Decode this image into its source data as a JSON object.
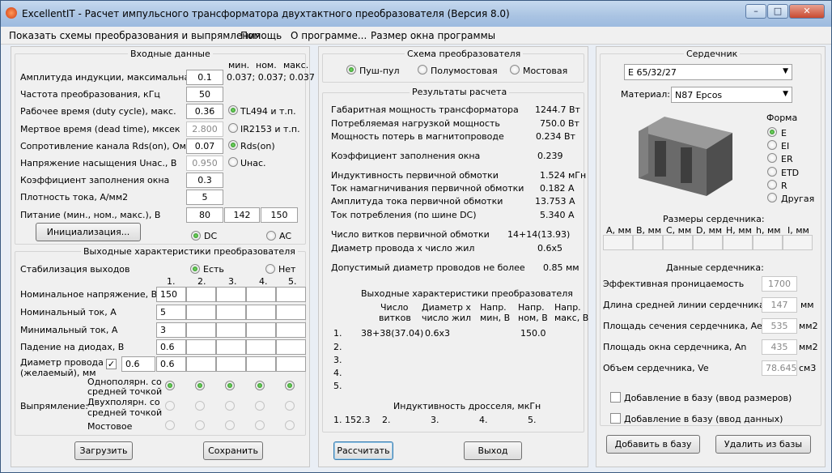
{
  "window": {
    "title": "ExcellentIT - Расчет импульсного трансформатора двухтактного преобразователя (Версия 8.0)",
    "minimize": "–",
    "maximize": "□",
    "close": "✕"
  },
  "menu": [
    "Показать схемы преобразования и выпрямления",
    "Помощь",
    "О программе...",
    "Размер окна программы"
  ],
  "input": {
    "title": "Входные данные",
    "col_headers": [
      "мин.",
      "ном.",
      "макс."
    ],
    "bmax_range": "0.037; 0.037; 0.037",
    "rows": [
      {
        "label": "Амплитуда индукции, максимальная, Т",
        "value": "0.1"
      },
      {
        "label": "Частота преобразования, кГц",
        "value": "50"
      },
      {
        "label": "Рабочее время (duty cycle), макс.",
        "value": "0.36"
      },
      {
        "label": "Мертвое время (dead time), мксек",
        "value": "2.800"
      },
      {
        "label": "Сопротивление канала Rds(on), Ом",
        "value": "0.07"
      },
      {
        "label": "Напряжение насыщения Uнас., В",
        "value": "0.950"
      },
      {
        "label": "Коэффициент заполнения окна",
        "value": "0.3"
      },
      {
        "label": "Плотность тока, А/мм2",
        "value": "5"
      },
      {
        "label": "Питание (мин., ном., макс.), В",
        "value": "80"
      }
    ],
    "supply_nom": "142",
    "supply_max": "150",
    "ctrl": [
      "TL494 и т.п.",
      "IR2153 и т.п.",
      "Rds(on)",
      "Uнас."
    ],
    "init_button": "Инициализация...",
    "dc": "DC",
    "ac": "AC"
  },
  "outputs": {
    "title": "Выходные характеристики преобразователя",
    "stab_label": "Стабилизация выходов",
    "stab_yes": "Есть",
    "stab_no": "Нет",
    "cols": [
      "1.",
      "2.",
      "3.",
      "4.",
      "5."
    ],
    "rows": [
      {
        "label": "Номинальное напряжение, В",
        "v1": "150"
      },
      {
        "label": "Номинальный ток, А",
        "v1": "5"
      },
      {
        "label": "Минимальный ток, А",
        "v1": "3"
      },
      {
        "label": "Падение на диодах, В",
        "v1": "0.6"
      }
    ],
    "wire_label1": "Диаметр провода",
    "wire_label2": "(желаемый), мм",
    "wire_chk": "0.6",
    "wire_v1": "0.6",
    "rect_label": "Выпрямление:",
    "rect_opts": [
      "Однополярн. со",
      "средней точкой",
      "Двухполярн. со",
      "средней точкой",
      "Мостовое"
    ]
  },
  "buttons": {
    "load": "Загрузить",
    "save": "Сохранить",
    "calc": "Рассчитать",
    "exit": "Выход",
    "add": "Добавить в базу",
    "remove": "Удалить из базы"
  },
  "scheme": {
    "title": "Схема преобразователя",
    "opts": [
      "Пуш-пул",
      "Полумостовая",
      "Мостовая"
    ]
  },
  "results": {
    "title": "Результаты расчета",
    "rows": [
      {
        "label": "Габаритная мощность трансформатора",
        "value": "1244.7 Вт"
      },
      {
        "label": "Потребляемая нагрузкой мощность",
        "value": "750.0 Вт"
      },
      {
        "label": "Мощность потерь в магнитопроводе",
        "value": "0.234 Вт"
      },
      {
        "label": "Коэффициент заполнения окна",
        "value": "0.239"
      },
      {
        "label": "Индуктивность первичной обмотки",
        "value": "1.524 мГн"
      },
      {
        "label": "Ток намагничивания первичной обмотки",
        "value": "0.182 А"
      },
      {
        "label": "Амплитуда тока первичной обмотки",
        "value": "13.753 А"
      },
      {
        "label": "Ток потребления (по шине DC)",
        "value": "5.340 А"
      },
      {
        "label": "Число витков первичной обмотки",
        "value": "14+14(13.93)"
      },
      {
        "label": "Диаметр провода х число жил",
        "value": "0.6х5"
      },
      {
        "label": "Допустимый диаметр проводов не более",
        "value": "0.85 мм"
      }
    ],
    "out_title": "Выходные характеристики преобразователя",
    "out_headers": [
      [
        "Число",
        "витков"
      ],
      [
        "Диаметр х",
        "число жил"
      ],
      [
        "Напр.",
        "мин, В"
      ],
      [
        "Напр.",
        "ном, В"
      ],
      [
        "Напр.",
        "макс, В"
      ]
    ],
    "out_rows": [
      [
        "1.",
        "38+38(37.04)",
        "0.6х3",
        "",
        "150.0",
        ""
      ],
      [
        "2."
      ],
      [
        "3."
      ],
      [
        "4."
      ],
      [
        "5."
      ]
    ],
    "choke_title": "Индуктивность дросселя, мкГн",
    "choke": [
      "1. 152.3",
      "2.",
      "3.",
      "4.",
      "5."
    ]
  },
  "core": {
    "title": "Сердечник",
    "name": "E 65/32/27",
    "material_label": "Материал:",
    "material": "N87 Epcos",
    "shape_title": "Форма",
    "shapes": [
      "E",
      "EI",
      "ER",
      "ETD",
      "R",
      "Другая"
    ],
    "dims_title": "Размеры сердечника:",
    "dims": [
      "A, мм",
      "B, мм",
      "C, мм",
      "D, мм",
      "H, мм",
      "h, мм",
      "I, мм"
    ],
    "data_title": "Данные сердечника:",
    "data": [
      {
        "label": "Эффективная проницаемость",
        "value": "1700",
        "unit": ""
      },
      {
        "label": "Длина средней линии сердечника, le",
        "value": "147",
        "unit": "мм"
      },
      {
        "label": "Площадь сечения сердечника, Ae",
        "value": "535",
        "unit": "мм2"
      },
      {
        "label": "Площадь окна сердечника, An",
        "value": "435",
        "unit": "мм2"
      },
      {
        "label": "Объем сердечника, Ve",
        "value": "78.645",
        "unit": "см3"
      }
    ],
    "add_dims": "Добавление в базу (ввод размеров)",
    "add_data": "Добавление в базу (ввод данных)"
  }
}
